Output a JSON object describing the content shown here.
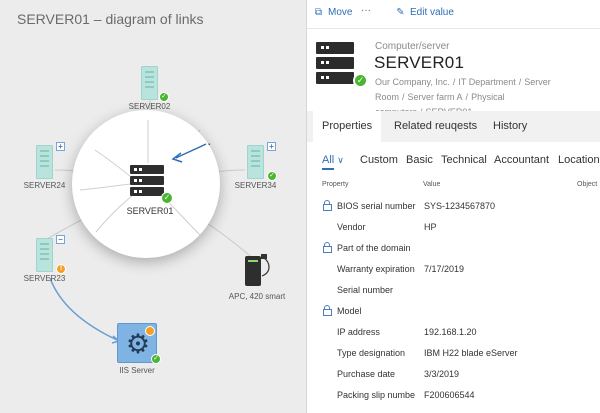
{
  "diagram": {
    "title": "SERVER01 – diagram of links",
    "nodes": {
      "top_label": "SERVER02",
      "left_label": "SERVER24",
      "right_label": "SERVER34",
      "lower_left_label": "SERVER23",
      "focus_label": "SERVER01",
      "apc_label": "APC, 420 smart",
      "iis_label": "IIS Server"
    },
    "expander_plus": "+",
    "expander_minus": "−"
  },
  "toolbar": {
    "move_label": "Move",
    "more_label": "···",
    "edit_label": "Edit value"
  },
  "header": {
    "type": "Computer/server",
    "name": "SERVER01",
    "breadcrumb": [
      "Our Company, Inc.",
      "IT Department",
      "Server Room",
      "Server farm A",
      "Physical computers",
      "SERVER01"
    ]
  },
  "tabs": [
    "Properties",
    "Related reuqests",
    "History"
  ],
  "filters": [
    "All",
    "Custom",
    "Basic",
    "Technical",
    "Accountant",
    "Location"
  ],
  "columns": {
    "property": "Property",
    "value": "Value",
    "object": "Object"
  },
  "properties": [
    {
      "name": "BIOS serial number",
      "value": "SYS-1234567870",
      "group": true
    },
    {
      "name": "Vendor",
      "value": "HP",
      "group": false
    },
    {
      "name": "Part of the domain",
      "value": "",
      "group": true
    },
    {
      "name": "Warranty expiration",
      "value": "7/17/2019",
      "group": false
    },
    {
      "name": "Serial number",
      "value": "",
      "group": false
    },
    {
      "name": "Model",
      "value": "",
      "group": true
    },
    {
      "name": "IP address",
      "value": "192.168.1.20",
      "group": false
    },
    {
      "name": "Type designation",
      "value": "IBM H22 blade eServer",
      "group": false
    },
    {
      "name": "Purchase date",
      "value": "3/3/2019",
      "group": false
    },
    {
      "name": "Packing slip numbe",
      "value": "F200606544",
      "group": false
    }
  ],
  "colors": {
    "accent": "#2f6db5",
    "status_ok": "#4ab52f",
    "status_warn": "#f5a023",
    "server_teal": "#b9e3dd"
  }
}
